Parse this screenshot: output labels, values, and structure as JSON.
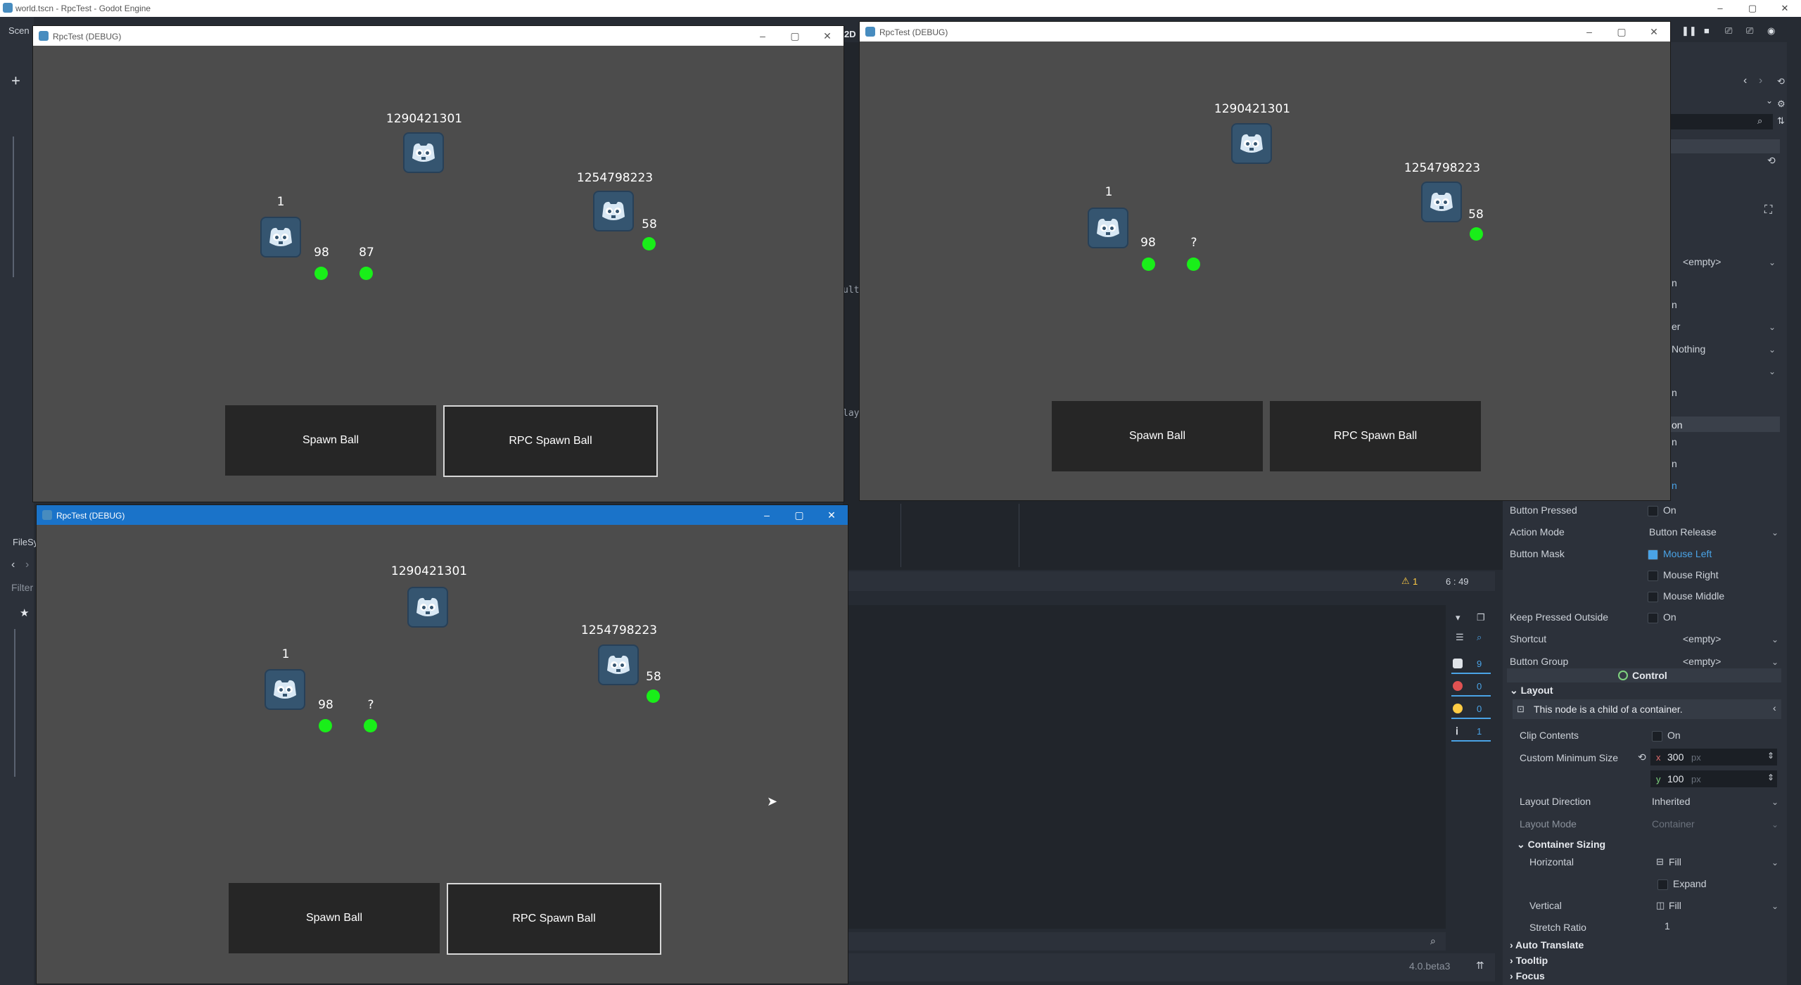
{
  "editor": {
    "window_title": "world.tscn - RpcTest - Godot Engine",
    "scene_tab": "Scen",
    "filesystem_tab": "FileSy",
    "filter_placeholder": "Filter",
    "mode_2d": "2D",
    "code_fragments": [
      "ult",
      "lay"
    ],
    "status_warnings": "1",
    "cursor_pos": "6 :  49",
    "version": "4.0.beta3",
    "debugger_counts": [
      "9",
      "0",
      "0",
      "1"
    ],
    "window_controls": {
      "min": "–",
      "max": "▢",
      "close": "✕"
    }
  },
  "game_windows": [
    {
      "title": "RpcTest (DEBUG)",
      "peers": {
        "server": "1290421301",
        "left": "1",
        "right": "1254798223"
      },
      "ball_values": [
        "98",
        "87",
        "58"
      ],
      "buttons": {
        "spawn": "Spawn Ball",
        "rpc_spawn": "RPC Spawn Ball"
      }
    },
    {
      "title": "RpcTest (DEBUG)",
      "peers": {
        "server": "1290421301",
        "left": "1",
        "right": "1254798223"
      },
      "ball_values": [
        "98",
        "?",
        "58"
      ],
      "buttons": {
        "spawn": "Spawn Ball",
        "rpc_spawn": "RPC Spawn Ball"
      }
    },
    {
      "title": "RpcTest (DEBUG)",
      "peers": {
        "server": "1290421301",
        "left": "1",
        "right": "1254798223"
      },
      "ball_values": [
        "98",
        "?",
        "58"
      ],
      "buttons": {
        "spawn": "Spawn Ball",
        "rpc_spawn": "RPC Spawn Ball"
      }
    }
  ],
  "inspector": {
    "partial_values": [
      "<empty>",
      "n",
      "n",
      "er",
      "Nothing",
      "n",
      "on",
      "n",
      "n",
      "n"
    ],
    "button_pressed": {
      "label": "Button Pressed",
      "value": "On"
    },
    "action_mode": {
      "label": "Action Mode",
      "value": "Button Release"
    },
    "button_mask": {
      "label": "Button Mask",
      "options": [
        "Mouse Left",
        "Mouse Right",
        "Mouse Middle"
      ]
    },
    "keep_pressed": {
      "label": "Keep Pressed Outside",
      "value": "On"
    },
    "shortcut": {
      "label": "Shortcut",
      "value": "<empty>"
    },
    "button_group": {
      "label": "Button Group",
      "value": "<empty>"
    },
    "control_header": "Control",
    "layout_section": "Layout",
    "container_note": "This node is a child of a container.",
    "clip_contents": {
      "label": "Clip Contents",
      "value": "On"
    },
    "custom_min_size": {
      "label": "Custom Minimum Size",
      "x": "300",
      "y": "100",
      "unit": "px",
      "x_axis": "x",
      "y_axis": "y"
    },
    "layout_direction": {
      "label": "Layout Direction",
      "value": "Inherited"
    },
    "layout_mode": {
      "label": "Layout Mode",
      "value": "Container"
    },
    "container_sizing": "Container Sizing",
    "horizontal": {
      "label": "Horizontal",
      "value": "Fill",
      "expand": "Expand"
    },
    "vertical": {
      "label": "Vertical",
      "value": "Fill"
    },
    "stretch_ratio": {
      "label": "Stretch Ratio",
      "value": "1"
    },
    "collapsed_sections": [
      "Auto Translate",
      "Tooltip",
      "Focus"
    ]
  }
}
